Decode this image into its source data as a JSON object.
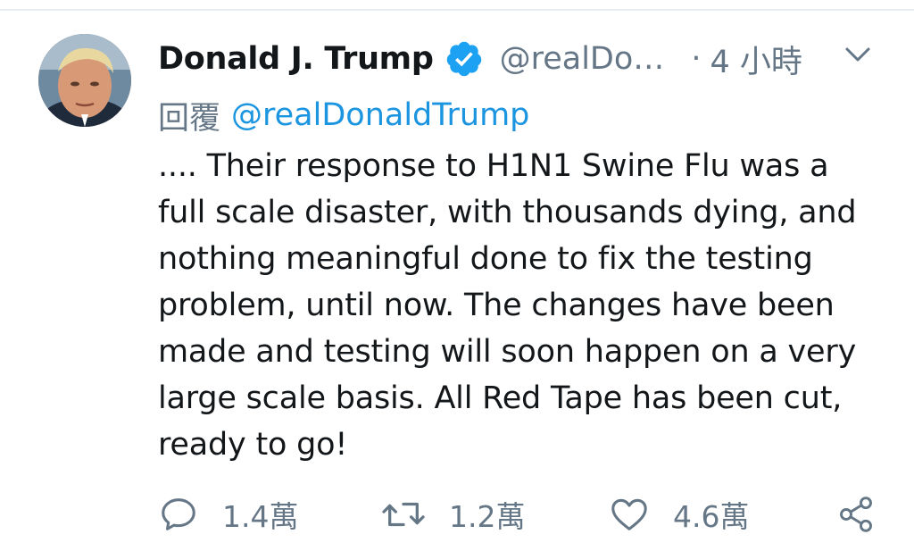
{
  "tweet": {
    "author_name": "Donald J. Trump",
    "handle": "@realDo…",
    "separator": "·",
    "time": "4 小時",
    "reply_label": "回覆",
    "reply_to": "@realDonaldTrump",
    "text_lines": [
      ".... Their response to H1N1 Swine Flu was a",
      "full scale disaster, with thousands dying, and",
      "nothing meaningful done to fix the testing",
      "problem, until now. The changes have been",
      "made and testing will soon happen on a very",
      "large scale basis. All Red Tape has been cut,",
      "ready to go!"
    ],
    "verified": true
  },
  "actions": {
    "reply_count": "1.4萬",
    "retweet_count": "1.2萬",
    "like_count": "4.6萬"
  },
  "icons": {
    "verified": "verified-badge-icon",
    "menu": "chevron-down-icon",
    "reply": "reply-bubble-icon",
    "retweet": "retweet-icon",
    "like": "heart-icon",
    "share": "share-icon"
  },
  "colors": {
    "text": "#14171a",
    "secondary": "#657786",
    "link": "#1b95e0",
    "verified": "#1da1f2",
    "divider": "#e6ecf0"
  }
}
